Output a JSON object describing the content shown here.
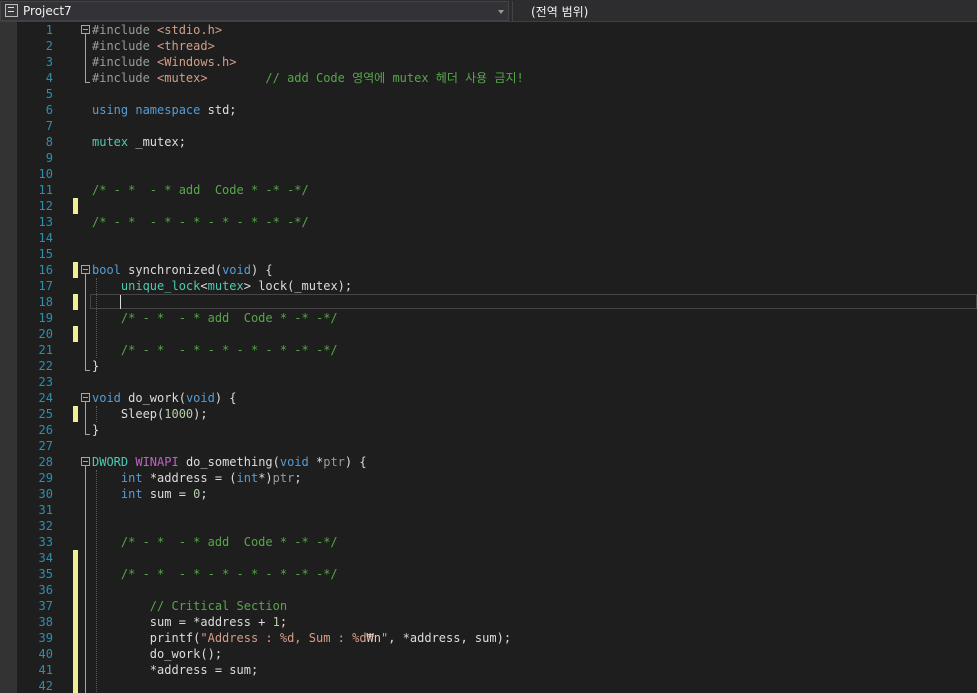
{
  "navbar": {
    "project_label": "Project7",
    "scope_label": "(전역 범위)"
  },
  "colors": {
    "background": "#1e1e1e",
    "line_number": "#2b91af",
    "change_marker": "#efef91",
    "keyword": "#569cd6",
    "type": "#4ec9b0",
    "string": "#d69d85",
    "comment": "#57a64a",
    "macro": "#bd63c5"
  },
  "editor": {
    "caret_line": 18,
    "lines": [
      {
        "n": "1",
        "tokens": [
          [
            "dir",
            "#include "
          ],
          [
            "str",
            "<stdio.h>"
          ]
        ]
      },
      {
        "n": "2",
        "tokens": [
          [
            "dir",
            "#include "
          ],
          [
            "str",
            "<thread>"
          ]
        ]
      },
      {
        "n": "3",
        "tokens": [
          [
            "dir",
            "#include "
          ],
          [
            "str",
            "<Windows.h>"
          ]
        ]
      },
      {
        "n": "4",
        "tokens": [
          [
            "dir",
            "#include "
          ],
          [
            "str",
            "<mutex>"
          ],
          [
            "id",
            "        "
          ],
          [
            "cm",
            "// add Code 영역에 mutex 헤더 사용 금지!"
          ]
        ]
      },
      {
        "n": "5",
        "tokens": []
      },
      {
        "n": "6",
        "tokens": [
          [
            "kw",
            "using"
          ],
          [
            "id",
            " "
          ],
          [
            "kw",
            "namespace"
          ],
          [
            "id",
            " std;"
          ]
        ]
      },
      {
        "n": "7",
        "tokens": []
      },
      {
        "n": "8",
        "tokens": [
          [
            "ty",
            "mutex"
          ],
          [
            "id",
            " _mutex;"
          ]
        ]
      },
      {
        "n": "9",
        "tokens": []
      },
      {
        "n": "10",
        "tokens": []
      },
      {
        "n": "11",
        "tokens": [
          [
            "cm",
            "/* - *  - * add  Code * -* -*/"
          ]
        ]
      },
      {
        "n": "12",
        "tokens": []
      },
      {
        "n": "13",
        "tokens": [
          [
            "cm",
            "/* - *  - * - * - * - * -* -*/"
          ]
        ]
      },
      {
        "n": "14",
        "tokens": []
      },
      {
        "n": "15",
        "tokens": []
      },
      {
        "n": "16",
        "tokens": [
          [
            "kw",
            "bool"
          ],
          [
            "id",
            " synchronized("
          ],
          [
            "kw",
            "void"
          ],
          [
            "id",
            ") {"
          ]
        ]
      },
      {
        "n": "17",
        "tokens": [
          [
            "id",
            "    "
          ],
          [
            "ty",
            "unique_lock"
          ],
          [
            "id",
            "<"
          ],
          [
            "ty",
            "mutex"
          ],
          [
            "id",
            "> lock(_mutex);"
          ]
        ]
      },
      {
        "n": "18",
        "tokens": [
          [
            "id",
            "    "
          ]
        ]
      },
      {
        "n": "19",
        "tokens": [
          [
            "id",
            "    "
          ],
          [
            "cm",
            "/* - *  - * add  Code * -* -*/"
          ]
        ]
      },
      {
        "n": "20",
        "tokens": []
      },
      {
        "n": "21",
        "tokens": [
          [
            "id",
            "    "
          ],
          [
            "cm",
            "/* - *  - * - * - * - * -* -*/"
          ]
        ]
      },
      {
        "n": "22",
        "tokens": [
          [
            "id",
            "}"
          ]
        ]
      },
      {
        "n": "23",
        "tokens": []
      },
      {
        "n": "24",
        "tokens": [
          [
            "kw",
            "void"
          ],
          [
            "id",
            " do_work("
          ],
          [
            "kw",
            "void"
          ],
          [
            "id",
            ") {"
          ]
        ]
      },
      {
        "n": "25",
        "tokens": [
          [
            "id",
            "    Sleep("
          ],
          [
            "num",
            "1000"
          ],
          [
            "id",
            ");"
          ]
        ]
      },
      {
        "n": "26",
        "tokens": [
          [
            "id",
            "}"
          ]
        ]
      },
      {
        "n": "27",
        "tokens": []
      },
      {
        "n": "28",
        "tokens": [
          [
            "ty",
            "DWORD"
          ],
          [
            "id",
            " "
          ],
          [
            "mac",
            "WINAPI"
          ],
          [
            "id",
            " do_something("
          ],
          [
            "kw",
            "void"
          ],
          [
            "id",
            " *"
          ],
          [
            "par",
            "ptr"
          ],
          [
            "id",
            ") {"
          ]
        ]
      },
      {
        "n": "29",
        "tokens": [
          [
            "id",
            "    "
          ],
          [
            "kw",
            "int"
          ],
          [
            "id",
            " *address = ("
          ],
          [
            "kw",
            "int"
          ],
          [
            "id",
            "*)"
          ],
          [
            "par",
            "ptr"
          ],
          [
            "id",
            ";"
          ]
        ]
      },
      {
        "n": "30",
        "tokens": [
          [
            "id",
            "    "
          ],
          [
            "kw",
            "int"
          ],
          [
            "id",
            " sum = "
          ],
          [
            "num",
            "0"
          ],
          [
            "id",
            ";"
          ]
        ]
      },
      {
        "n": "31",
        "tokens": []
      },
      {
        "n": "32",
        "tokens": []
      },
      {
        "n": "33",
        "tokens": [
          [
            "id",
            "    "
          ],
          [
            "cm",
            "/* - *  - * add  Code * -* -*/"
          ]
        ]
      },
      {
        "n": "34",
        "tokens": []
      },
      {
        "n": "35",
        "tokens": [
          [
            "id",
            "    "
          ],
          [
            "cm",
            "/* - *  - * - * - * - * -* -*/"
          ]
        ]
      },
      {
        "n": "36",
        "tokens": []
      },
      {
        "n": "37",
        "tokens": [
          [
            "id",
            "        "
          ],
          [
            "cm",
            "// Critical Section"
          ]
        ]
      },
      {
        "n": "38",
        "tokens": [
          [
            "id",
            "        sum = *address + "
          ],
          [
            "num",
            "1"
          ],
          [
            "id",
            ";"
          ]
        ]
      },
      {
        "n": "39",
        "tokens": [
          [
            "id",
            "        printf("
          ],
          [
            "str",
            "\"Address : %d, Sum : %d"
          ],
          [
            "esc",
            "₩n"
          ],
          [
            "str",
            "\""
          ],
          [
            "id",
            ", *address, sum);"
          ]
        ]
      },
      {
        "n": "40",
        "tokens": [
          [
            "id",
            "        do_work();"
          ]
        ]
      },
      {
        "n": "41",
        "tokens": [
          [
            "id",
            "        *address = sum;"
          ]
        ]
      },
      {
        "n": "42",
        "tokens": []
      }
    ]
  }
}
